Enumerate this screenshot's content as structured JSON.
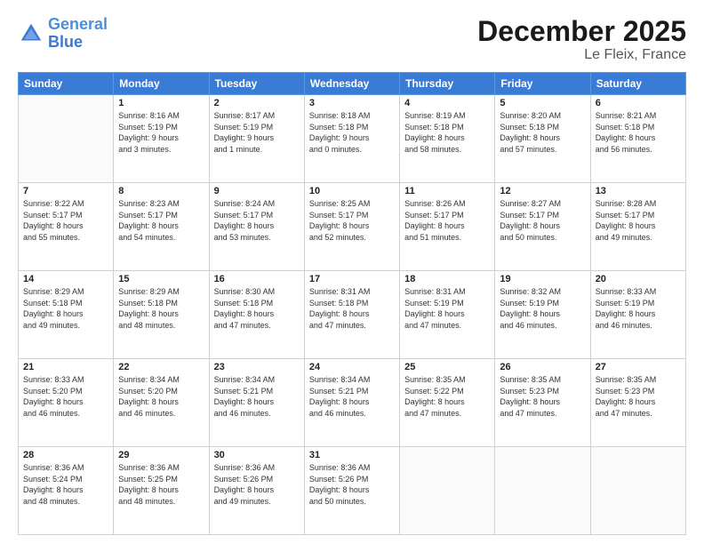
{
  "header": {
    "logo_line1": "General",
    "logo_line2": "Blue",
    "title": "December 2025",
    "subtitle": "Le Fleix, France"
  },
  "days_of_week": [
    "Sunday",
    "Monday",
    "Tuesday",
    "Wednesday",
    "Thursday",
    "Friday",
    "Saturday"
  ],
  "weeks": [
    [
      {
        "day": "",
        "sunrise": "",
        "sunset": "",
        "daylight": ""
      },
      {
        "day": "1",
        "sunrise": "Sunrise: 8:16 AM",
        "sunset": "Sunset: 5:19 PM",
        "daylight": "Daylight: 9 hours and 3 minutes."
      },
      {
        "day": "2",
        "sunrise": "Sunrise: 8:17 AM",
        "sunset": "Sunset: 5:19 PM",
        "daylight": "Daylight: 9 hours and 1 minute."
      },
      {
        "day": "3",
        "sunrise": "Sunrise: 8:18 AM",
        "sunset": "Sunset: 5:18 PM",
        "daylight": "Daylight: 9 hours and 0 minutes."
      },
      {
        "day": "4",
        "sunrise": "Sunrise: 8:19 AM",
        "sunset": "Sunset: 5:18 PM",
        "daylight": "Daylight: 8 hours and 58 minutes."
      },
      {
        "day": "5",
        "sunrise": "Sunrise: 8:20 AM",
        "sunset": "Sunset: 5:18 PM",
        "daylight": "Daylight: 8 hours and 57 minutes."
      },
      {
        "day": "6",
        "sunrise": "Sunrise: 8:21 AM",
        "sunset": "Sunset: 5:18 PM",
        "daylight": "Daylight: 8 hours and 56 minutes."
      }
    ],
    [
      {
        "day": "7",
        "sunrise": "Sunrise: 8:22 AM",
        "sunset": "Sunset: 5:17 PM",
        "daylight": "Daylight: 8 hours and 55 minutes."
      },
      {
        "day": "8",
        "sunrise": "Sunrise: 8:23 AM",
        "sunset": "Sunset: 5:17 PM",
        "daylight": "Daylight: 8 hours and 54 minutes."
      },
      {
        "day": "9",
        "sunrise": "Sunrise: 8:24 AM",
        "sunset": "Sunset: 5:17 PM",
        "daylight": "Daylight: 8 hours and 53 minutes."
      },
      {
        "day": "10",
        "sunrise": "Sunrise: 8:25 AM",
        "sunset": "Sunset: 5:17 PM",
        "daylight": "Daylight: 8 hours and 52 minutes."
      },
      {
        "day": "11",
        "sunrise": "Sunrise: 8:26 AM",
        "sunset": "Sunset: 5:17 PM",
        "daylight": "Daylight: 8 hours and 51 minutes."
      },
      {
        "day": "12",
        "sunrise": "Sunrise: 8:27 AM",
        "sunset": "Sunset: 5:17 PM",
        "daylight": "Daylight: 8 hours and 50 minutes."
      },
      {
        "day": "13",
        "sunrise": "Sunrise: 8:28 AM",
        "sunset": "Sunset: 5:17 PM",
        "daylight": "Daylight: 8 hours and 49 minutes."
      }
    ],
    [
      {
        "day": "14",
        "sunrise": "Sunrise: 8:29 AM",
        "sunset": "Sunset: 5:18 PM",
        "daylight": "Daylight: 8 hours and 49 minutes."
      },
      {
        "day": "15",
        "sunrise": "Sunrise: 8:29 AM",
        "sunset": "Sunset: 5:18 PM",
        "daylight": "Daylight: 8 hours and 48 minutes."
      },
      {
        "day": "16",
        "sunrise": "Sunrise: 8:30 AM",
        "sunset": "Sunset: 5:18 PM",
        "daylight": "Daylight: 8 hours and 47 minutes."
      },
      {
        "day": "17",
        "sunrise": "Sunrise: 8:31 AM",
        "sunset": "Sunset: 5:18 PM",
        "daylight": "Daylight: 8 hours and 47 minutes."
      },
      {
        "day": "18",
        "sunrise": "Sunrise: 8:31 AM",
        "sunset": "Sunset: 5:19 PM",
        "daylight": "Daylight: 8 hours and 47 minutes."
      },
      {
        "day": "19",
        "sunrise": "Sunrise: 8:32 AM",
        "sunset": "Sunset: 5:19 PM",
        "daylight": "Daylight: 8 hours and 46 minutes."
      },
      {
        "day": "20",
        "sunrise": "Sunrise: 8:33 AM",
        "sunset": "Sunset: 5:19 PM",
        "daylight": "Daylight: 8 hours and 46 minutes."
      }
    ],
    [
      {
        "day": "21",
        "sunrise": "Sunrise: 8:33 AM",
        "sunset": "Sunset: 5:20 PM",
        "daylight": "Daylight: 8 hours and 46 minutes."
      },
      {
        "day": "22",
        "sunrise": "Sunrise: 8:34 AM",
        "sunset": "Sunset: 5:20 PM",
        "daylight": "Daylight: 8 hours and 46 minutes."
      },
      {
        "day": "23",
        "sunrise": "Sunrise: 8:34 AM",
        "sunset": "Sunset: 5:21 PM",
        "daylight": "Daylight: 8 hours and 46 minutes."
      },
      {
        "day": "24",
        "sunrise": "Sunrise: 8:34 AM",
        "sunset": "Sunset: 5:21 PM",
        "daylight": "Daylight: 8 hours and 46 minutes."
      },
      {
        "day": "25",
        "sunrise": "Sunrise: 8:35 AM",
        "sunset": "Sunset: 5:22 PM",
        "daylight": "Daylight: 8 hours and 47 minutes."
      },
      {
        "day": "26",
        "sunrise": "Sunrise: 8:35 AM",
        "sunset": "Sunset: 5:23 PM",
        "daylight": "Daylight: 8 hours and 47 minutes."
      },
      {
        "day": "27",
        "sunrise": "Sunrise: 8:35 AM",
        "sunset": "Sunset: 5:23 PM",
        "daylight": "Daylight: 8 hours and 47 minutes."
      }
    ],
    [
      {
        "day": "28",
        "sunrise": "Sunrise: 8:36 AM",
        "sunset": "Sunset: 5:24 PM",
        "daylight": "Daylight: 8 hours and 48 minutes."
      },
      {
        "day": "29",
        "sunrise": "Sunrise: 8:36 AM",
        "sunset": "Sunset: 5:25 PM",
        "daylight": "Daylight: 8 hours and 48 minutes."
      },
      {
        "day": "30",
        "sunrise": "Sunrise: 8:36 AM",
        "sunset": "Sunset: 5:26 PM",
        "daylight": "Daylight: 8 hours and 49 minutes."
      },
      {
        "day": "31",
        "sunrise": "Sunrise: 8:36 AM",
        "sunset": "Sunset: 5:26 PM",
        "daylight": "Daylight: 8 hours and 50 minutes."
      },
      {
        "day": "",
        "sunrise": "",
        "sunset": "",
        "daylight": ""
      },
      {
        "day": "",
        "sunrise": "",
        "sunset": "",
        "daylight": ""
      },
      {
        "day": "",
        "sunrise": "",
        "sunset": "",
        "daylight": ""
      }
    ]
  ]
}
